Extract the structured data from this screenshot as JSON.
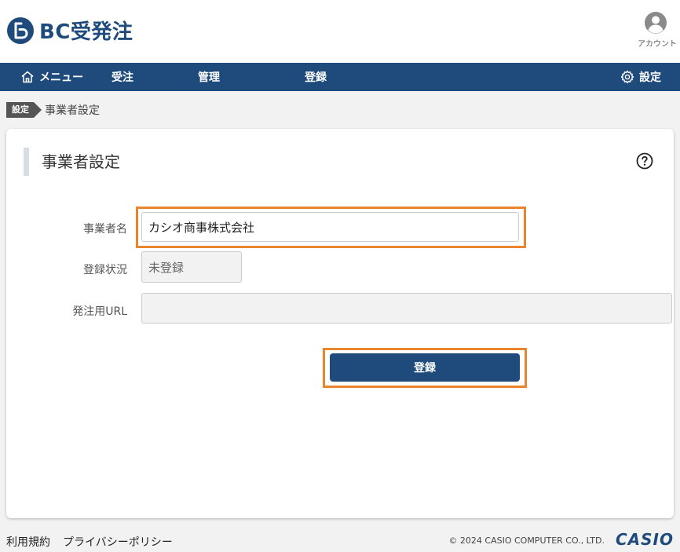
{
  "app": {
    "logo_text": "BC受発注",
    "account_label": "アカウント"
  },
  "nav": {
    "menu_label": "メニュー",
    "order_label": "受注",
    "manage_label": "管理",
    "register_label": "登録",
    "settings_label": "設定"
  },
  "breadcrumb": {
    "parent": "設定",
    "current": "事業者設定"
  },
  "page": {
    "title": "事業者設定"
  },
  "form": {
    "business_name_label": "事業者名",
    "business_name_value": "カシオ商事株式会社",
    "status_label": "登録状況",
    "status_value": "未登録",
    "url_label": "発注用URL",
    "url_value": "",
    "submit_label": "登録"
  },
  "footer": {
    "terms": "利用規約",
    "privacy": "プライバシーポリシー",
    "copyright": "© 2024 CASIO COMPUTER CO., LTD.",
    "brand": "CASIO"
  },
  "colors": {
    "brand": "#1f4b7c",
    "highlight": "#e8852d"
  }
}
